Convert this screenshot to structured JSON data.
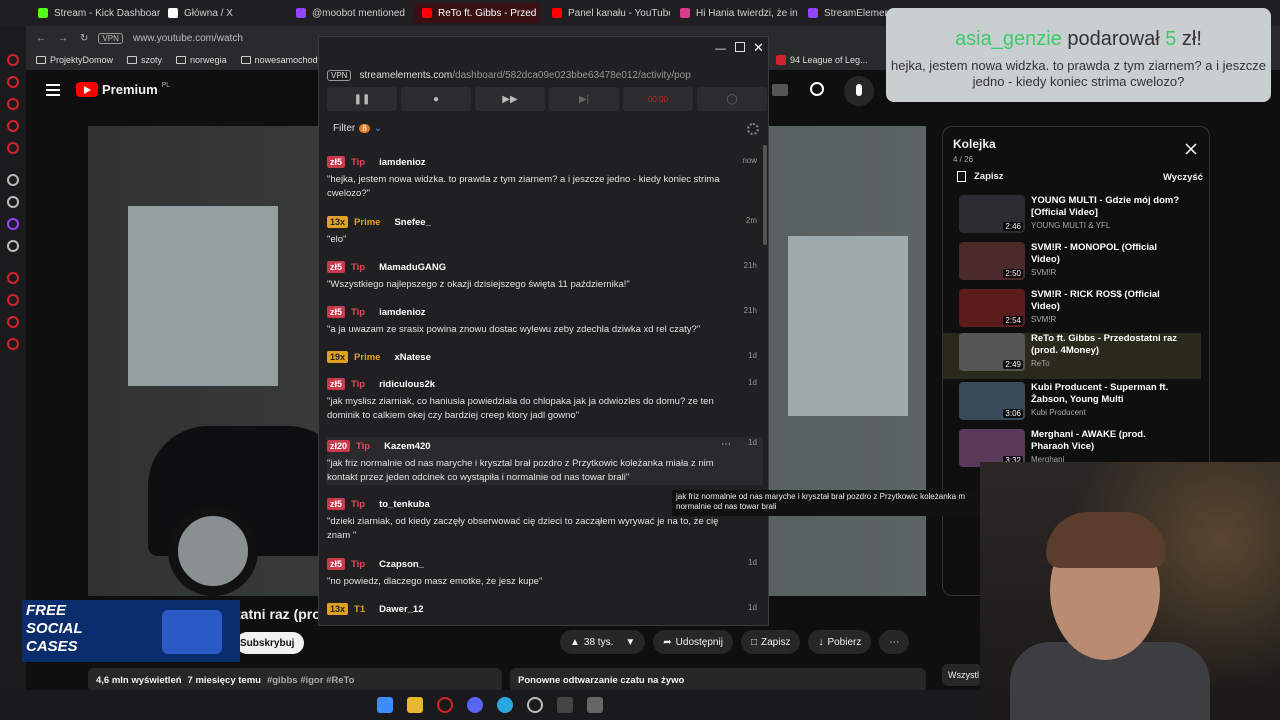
{
  "tabs": [
    {
      "label": "Stream - Kick Dashboard",
      "color": "#53fc18"
    },
    {
      "label": "Główna / X",
      "color": "#ffffff"
    },
    {
      "label": "@moobot mentioned",
      "color": "#9146ff"
    },
    {
      "label": "ReTo ft. Gibbs - Przed",
      "color": "#ff0000"
    },
    {
      "label": "Panel kanału - YouTube S",
      "color": "#ff0000"
    },
    {
      "label": "Hi Hania twierdzi, że influ",
      "color": "#d93a8d"
    },
    {
      "label": "StreamElements",
      "color": "#9146ff"
    }
  ],
  "address": {
    "vpn": "VPN",
    "url": "www.youtube.com/watch"
  },
  "bookmarks": [
    "ProjektyDomow",
    "szoty",
    "norwegia",
    "nowesamochody"
  ],
  "bookmark_right": "94 League of Leg...",
  "youtube": {
    "logo": "Premium",
    "region": "PL",
    "title_fragment": "tatni raz (prod",
    "subscribe": "Subskrybuj",
    "likes": "38 tys.",
    "share": "Udostępnij",
    "save": "Zapisz",
    "download": "Pobierz",
    "views": "4,6 mln wyświetleń",
    "age": "7 miesięcy temu",
    "tags": "#gibbs #igor #ReTo",
    "chat_replay": "Ponowne odtwarzanie czatu na żywo",
    "wszystkie": "Wszystl"
  },
  "queue": {
    "title": "Kolejka",
    "count": "4 / 26",
    "save": "Zapisz",
    "clear": "Wyczyść",
    "items": [
      {
        "title": "YOUNG MULTI - Gdzie mój dom? [Official Video]",
        "channel": "YOUNG MULTI & YFL",
        "dur": "2:46"
      },
      {
        "title": "SVM!R - MONOPOL (Official Video)",
        "channel": "SVM!R",
        "dur": "2:50"
      },
      {
        "title": "SVM!R - RICK ROS$ (Official Video)",
        "channel": "SVM!R",
        "dur": "2:54"
      },
      {
        "title": "ReTo ft. Gibbs - Przedostatni raz (prod. 4Money)",
        "channel": "ReTo",
        "dur": "2:49"
      },
      {
        "title": "Kubi Producent - Superman ft. Żabson, Young Multi",
        "channel": "Kubi Producent",
        "dur": "3:06"
      },
      {
        "title": "Merghani - AWAKE (prod. Pharaoh Vice)",
        "channel": "Merghani",
        "dur": "3:32"
      }
    ]
  },
  "popup": {
    "vpn": "VPN",
    "url_host": "streamelements.com",
    "url_path": "/dashboard/582dca09e023bbe63478e012/activity/pop",
    "timer": "00:00",
    "filter": "Filter",
    "filter_count": "8",
    "events": [
      {
        "badge": "zł5",
        "type": "Tip",
        "kind": "tip",
        "user": "iamdenioz",
        "time": "now",
        "msg": "\"hejka, jestem nowa widzka. to prawda z tym ziarnem? a i jeszcze jedno - kiedy koniec strima cwelozo?\""
      },
      {
        "badge": "13x",
        "type": "Prime",
        "kind": "prime",
        "user": "Snefee_",
        "time": "2m",
        "msg": "\"elo\""
      },
      {
        "badge": "zł5",
        "type": "Tip",
        "kind": "tip",
        "user": "MamaduGANG",
        "time": "21h",
        "msg": "\"Wszystkiego najlepszego z okazji dzisiejszego święta 11 października!\""
      },
      {
        "badge": "zł5",
        "type": "Tip",
        "kind": "tip",
        "user": "iamdenioz",
        "time": "21h",
        "msg": "\"a ja uwazam ze srasix powina znowu dostac wylewu zeby zdechla dziwka xd rel czaty?\""
      },
      {
        "badge": "19x",
        "type": "Prime",
        "kind": "prime",
        "user": "xNatese",
        "time": "1d",
        "msg": ""
      },
      {
        "badge": "zł5",
        "type": "Tip",
        "kind": "tip",
        "user": "ridiculous2k",
        "time": "1d",
        "msg": "\"jak myslisz ziarniak, co haniusia powiedziala do chlopaka jak ja odwiozles do domu? ze ten dominik to calkiem okej czy bardziej creep ktory jadl gowno\""
      },
      {
        "badge": "zł20",
        "type": "Tip",
        "kind": "tip",
        "user": "Kazem420",
        "time": "1d",
        "msg": "\"jak friz normalnie od nas maryche i krysztal brał pozdro z Przytkowic koleżanka miała z nim kontakt przez jeden odcinek co wystąpiła i normalnie od nas towar brali\""
      },
      {
        "badge": "zł5",
        "type": "Tip",
        "kind": "tip",
        "user": "to_tenkuba",
        "time": "1d",
        "msg": "\"dzieki ziarniak, od kiedy zaczęły obserwować cię dzieci to zacząłem wyrywać je na to, że cię znam \""
      },
      {
        "badge": "zł5",
        "type": "Tip",
        "kind": "tip",
        "user": "Czapson_",
        "time": "1d",
        "msg": "\"no powiedz, dlaczego masz emotke, że jesz kupe\""
      },
      {
        "badge": "13x",
        "type": "T1",
        "kind": "prime",
        "user": "Dawer_12",
        "time": "1d",
        "msg": ""
      }
    ],
    "tooltip": "jak friz normalnie od nas maryche i kryształ brał pozdro z Przytkowic koleżanka m normalnie od nas towar brali"
  },
  "notification": {
    "user": "asia_genzie",
    "action": "podarował",
    "amount": "5",
    "currency": "zł!",
    "message": "hejka, jestem nowa widzka. to prawda z tym ziarnem? a i jeszcze jedno - kiedy koniec strima cwelozo?"
  },
  "ad": {
    "line1": "FREE",
    "line2": "SOCIAL",
    "line3": "CASES"
  }
}
